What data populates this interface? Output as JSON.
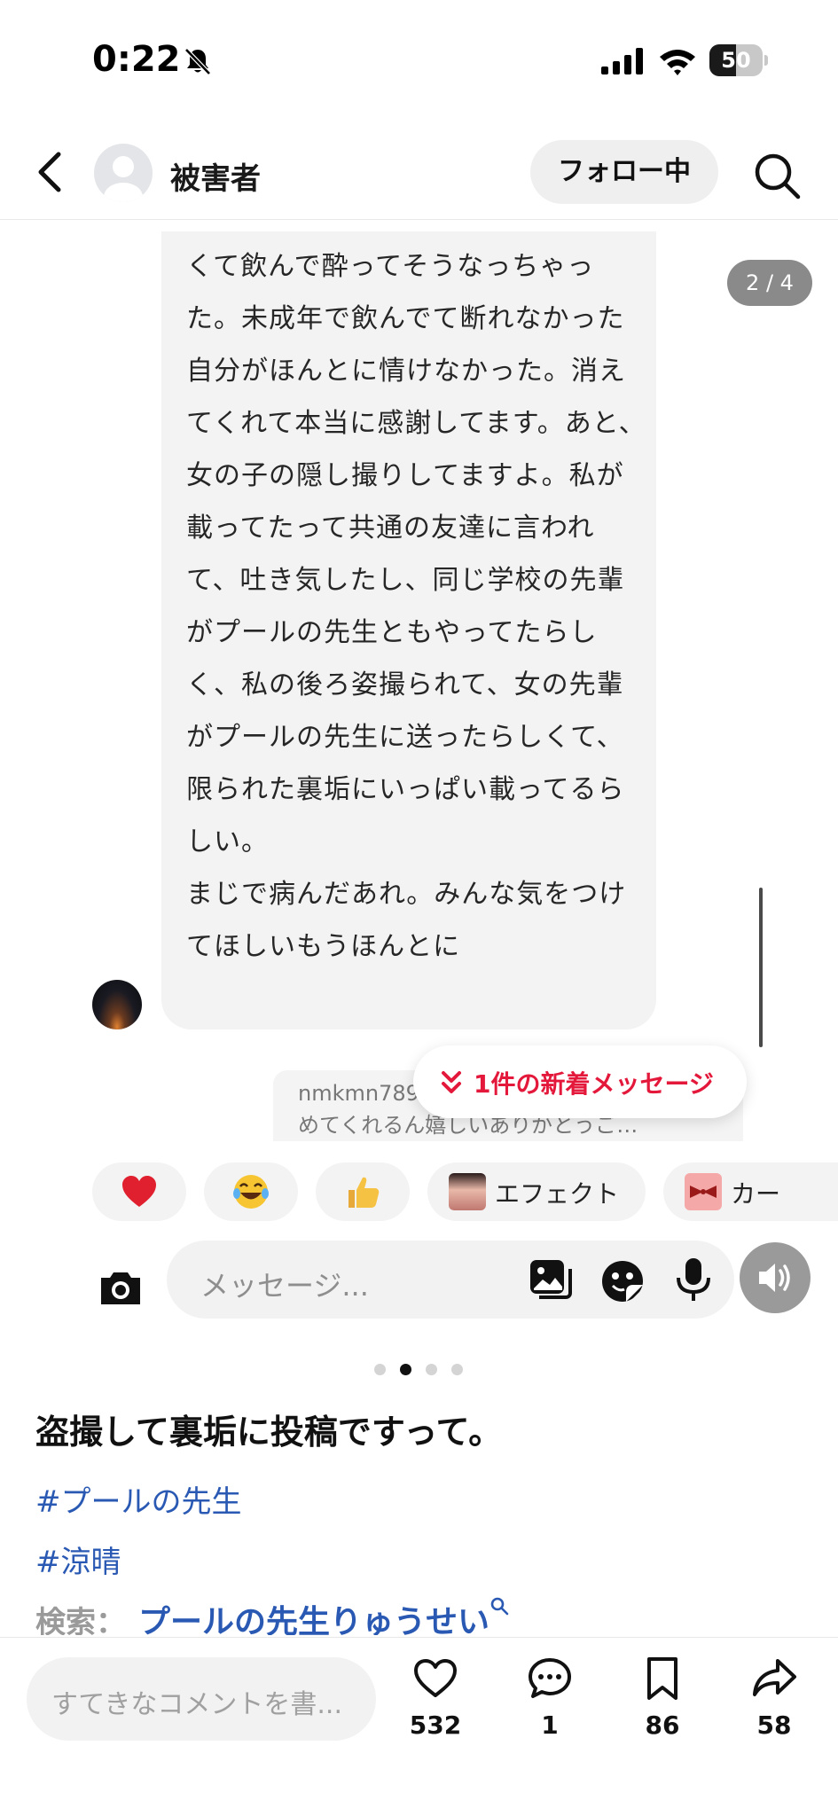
{
  "status_bar": {
    "time": "0:22",
    "battery": "50",
    "battery_level": 0.5
  },
  "header": {
    "username": "被害者",
    "follow_label": "フォロー中"
  },
  "post_image": {
    "counter": "2 / 4",
    "message_text": "くて飲んで酔ってそうなっちゃった。未成年で飲んでて断れなかった自分がほんとに情けなかった。消えてくれて本当に感謝してます。あと、女の子の隠し撮りしてますよ。私が載ってたって共通の友達に言われて、吐き気したし、同じ学校の先輩がプールの先生ともやってたらしく、私の後ろ姿撮られて、女の先輩がプールの先生に送ったらしくて、限られた裏垢にいっぱい載ってるらしい。\nまじで病んだあれ。みんな気をつけてほしいもうほんとに",
    "reply_user": "nmkmn789",
    "reply_text": "めてくれるん嬉しいありがとうご…",
    "new_message_label": "1件の新着メッセージ",
    "reactions": [
      {
        "emoji": "heart-emoji"
      },
      {
        "emoji": "laughing-emoji"
      },
      {
        "emoji": "thumbs-up-emoji"
      },
      {
        "label": "エフェクト"
      },
      {
        "label": "カー"
      }
    ],
    "message_placeholder": "メッセージ..."
  },
  "carousel": {
    "total": 4,
    "active": 2
  },
  "caption": {
    "text": "盗撮して裏垢に投稿ですって。",
    "hashtags": [
      "#プールの先生",
      "#涼晴"
    ],
    "search_prefix": "検索：",
    "search_link": "プールの先生りゅうせい"
  },
  "bottom_bar": {
    "comment_placeholder": "すてきなコメントを書...",
    "likes": "532",
    "comments": "1",
    "saves": "86",
    "shares": "58"
  },
  "colors": {
    "accent_red": "#e3183a",
    "link_blue": "#2a59b3",
    "heart_red": "#e0202e"
  }
}
